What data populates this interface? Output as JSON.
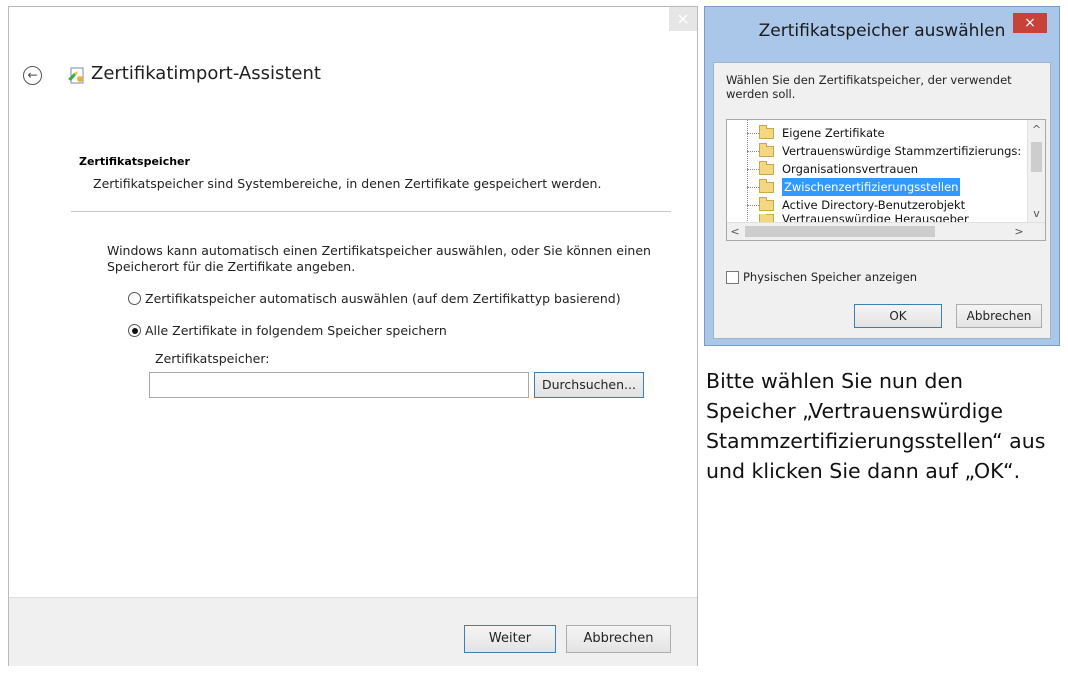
{
  "wizard": {
    "close_glyph": "×",
    "back_glyph": "←",
    "title": "Zertifikatimport-Assistent",
    "section_title": "Zertifikatspeicher",
    "section_desc": "Zertifikatspeicher sind Systembereiche, in denen Zertifikate gespeichert werden.",
    "intro": "Windows kann automatisch einen Zertifikatspeicher auswählen, oder Sie können einen Speicherort für die Zertifikate angeben.",
    "radio_auto": "Zertifikatspeicher automatisch auswählen (auf dem Zertifikattyp basierend)",
    "radio_manual": "Alle Zertifikate in folgendem Speicher speichern",
    "selected_option": "manual",
    "store_label": "Zertifikatspeicher:",
    "store_value": "",
    "browse_button": "Durchsuchen...",
    "next_button": "Weiter",
    "cancel_button": "Abbrechen"
  },
  "dialog": {
    "title": "Zertifikatspeicher auswählen",
    "close_glyph": "×",
    "prompt": "Wählen Sie den Zertifikatspeicher, der verwendet werden soll.",
    "stores": [
      {
        "label": "Eigene Zertifikate",
        "selected": false
      },
      {
        "label": "Vertrauenswürdige Stammzertifizierungs:",
        "selected": false
      },
      {
        "label": "Organisationsvertrauen",
        "selected": false
      },
      {
        "label": "Zwischenzertifizierungsstellen",
        "selected": true
      },
      {
        "label": "Active Directory-Benutzerobjekt",
        "selected": false
      },
      {
        "label": "Vertrauenswürdige Herausgeber",
        "selected": false
      }
    ],
    "show_physical_label": "Physischen Speicher anzeigen",
    "show_physical_checked": false,
    "ok_button": "OK",
    "cancel_button": "Abbrechen"
  },
  "instruction": "Bitte wählen Sie nun den Speicher „Vertrauenswürdige Stammzertifizierungsstellen“ aus und klicken Sie dann auf „OK“."
}
